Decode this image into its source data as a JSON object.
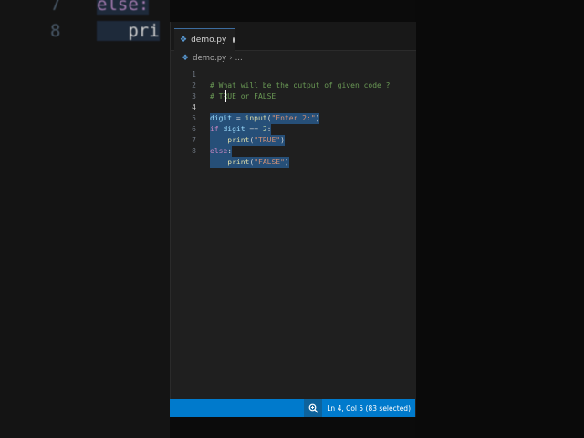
{
  "background": {
    "lines": [
      {
        "num": "7",
        "code": "else:"
      },
      {
        "num": "8",
        "code": "pri"
      }
    ]
  },
  "tab": {
    "filename": "demo.py",
    "icon": "python-file-icon",
    "modified": true
  },
  "breadcrumb": {
    "file": "demo.py",
    "rest": "..."
  },
  "code_lines": [
    {
      "num": "1",
      "text": "# What will be the output of given code ?"
    },
    {
      "num": "2",
      "text": "# TRUE or FALSE"
    },
    {
      "num": "3",
      "text": ""
    },
    {
      "num": "4",
      "text": "digit = input(\"Enter 2:\")"
    },
    {
      "num": "5",
      "text": "if digit == 2:"
    },
    {
      "num": "6",
      "text": "    print(\"TRUE\")"
    },
    {
      "num": "7",
      "text": "else:"
    },
    {
      "num": "8",
      "text": "    print(\"FALSE\")"
    }
  ],
  "status": {
    "position": "Ln 4, Col 5 (83 selected)",
    "zoom_icon": "zoom-in-icon"
  },
  "colors": {
    "statusbar": "#007acc",
    "selection": "#264f78",
    "editor_bg": "#1f1f1f"
  }
}
